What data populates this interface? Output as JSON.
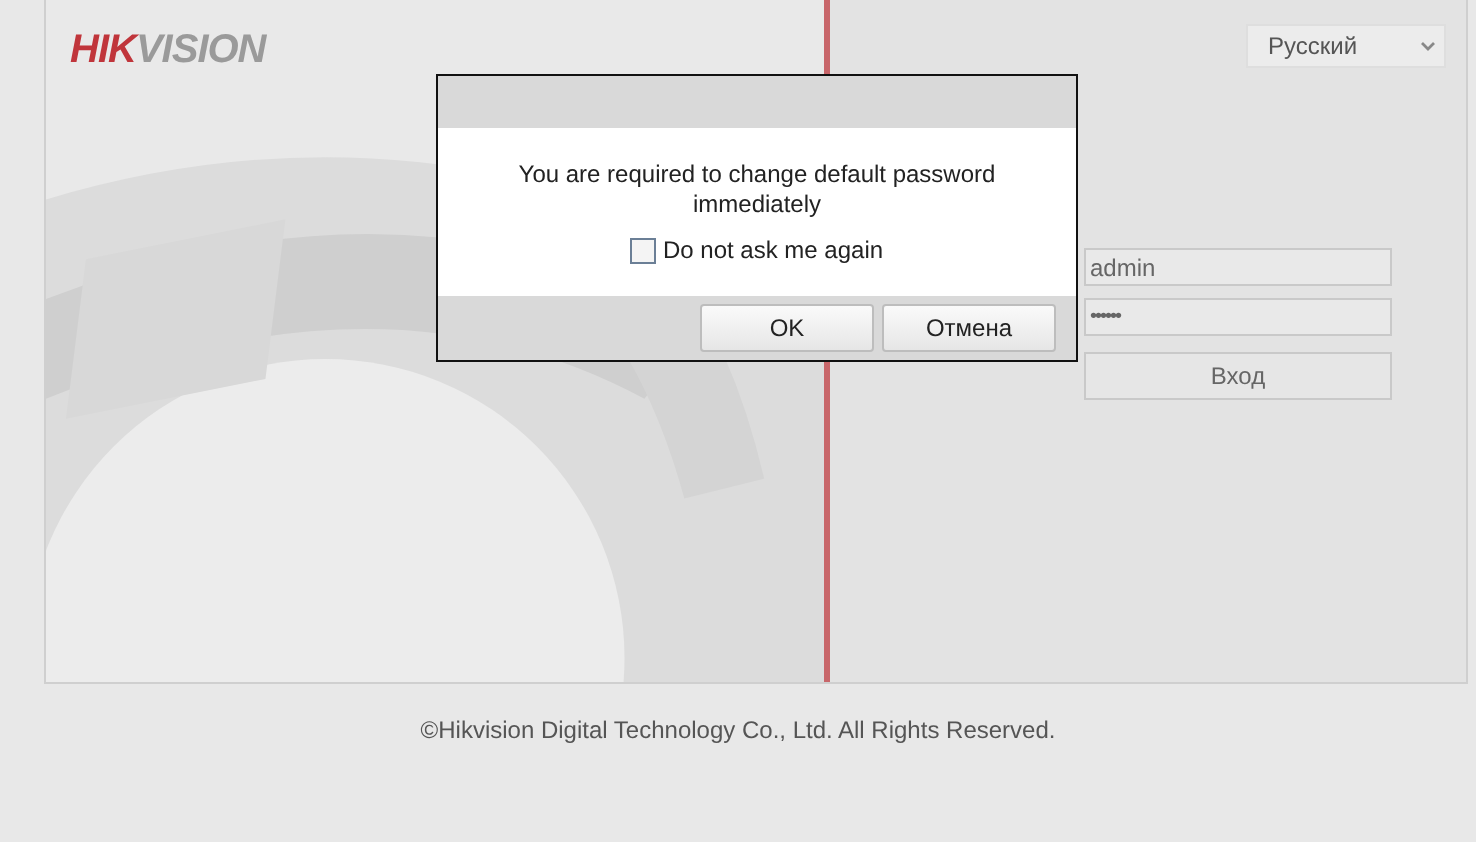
{
  "logo": {
    "primary": "HIK",
    "secondary": "VISION"
  },
  "language_select": {
    "value": "Русский"
  },
  "login": {
    "username": "admin",
    "password": "••••••",
    "button": "Вход"
  },
  "dialog": {
    "message": "You are required to change default password immediately",
    "checkbox": {
      "label": "Do not ask me again",
      "checked": false
    },
    "buttons": [
      "OK",
      "Отмена"
    ]
  },
  "footer": "©Hikvision Digital Technology Co., Ltd. All Rights Reserved."
}
